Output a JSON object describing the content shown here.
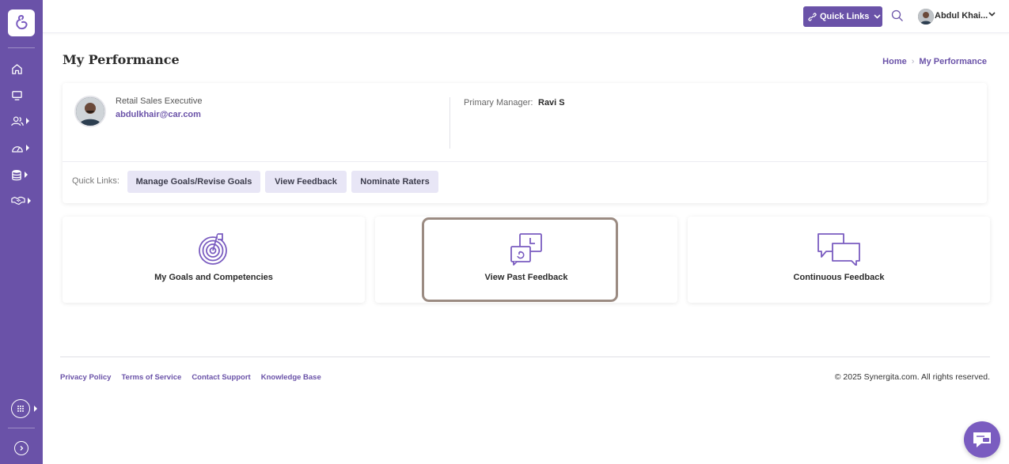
{
  "sidebar": {
    "logo": "synergita-logo",
    "items": [
      {
        "icon": "home-icon"
      },
      {
        "icon": "monitor-icon"
      },
      {
        "icon": "people-icon",
        "has_submenu": true
      },
      {
        "icon": "dashboard-gauge-icon",
        "has_submenu": true
      },
      {
        "icon": "database-icon",
        "has_submenu": true
      },
      {
        "icon": "handshake-icon",
        "has_submenu": true
      }
    ],
    "apps_icon": "apps-grid-icon",
    "expand_icon": "expand-sidebar-icon"
  },
  "topbar": {
    "quick_links_label": "Quick Links",
    "user_name": "Abdul Khai..."
  },
  "page": {
    "title": "My Performance",
    "breadcrumb": [
      "Home",
      "My Performance"
    ]
  },
  "profile": {
    "role": "Retail Sales Executive",
    "email": "abdulkhair@car.com",
    "primary_manager_label": "Primary Manager:",
    "primary_manager": "Ravi S",
    "quick_links_label": "Quick Links:",
    "quick_links": [
      "Manage Goals/Revise Goals",
      "View Feedback",
      "Nominate Raters"
    ]
  },
  "tiles": [
    {
      "label": "My Goals and Competencies",
      "icon": "target-flag-icon"
    },
    {
      "label": "View Past Feedback",
      "icon": "past-feedback-icon"
    },
    {
      "label": "Continuous Feedback",
      "icon": "chat-bubbles-icon"
    }
  ],
  "footer": {
    "links": [
      "Privacy Policy",
      "Terms of Service",
      "Contact Support",
      "Knowledge Base"
    ],
    "copyright": "© 2025 Synergita.com. All rights reserved."
  },
  "colors": {
    "brand": "#6a52a8",
    "chip_bg": "#e8e6f6",
    "highlight_border": "#9b8b82"
  }
}
